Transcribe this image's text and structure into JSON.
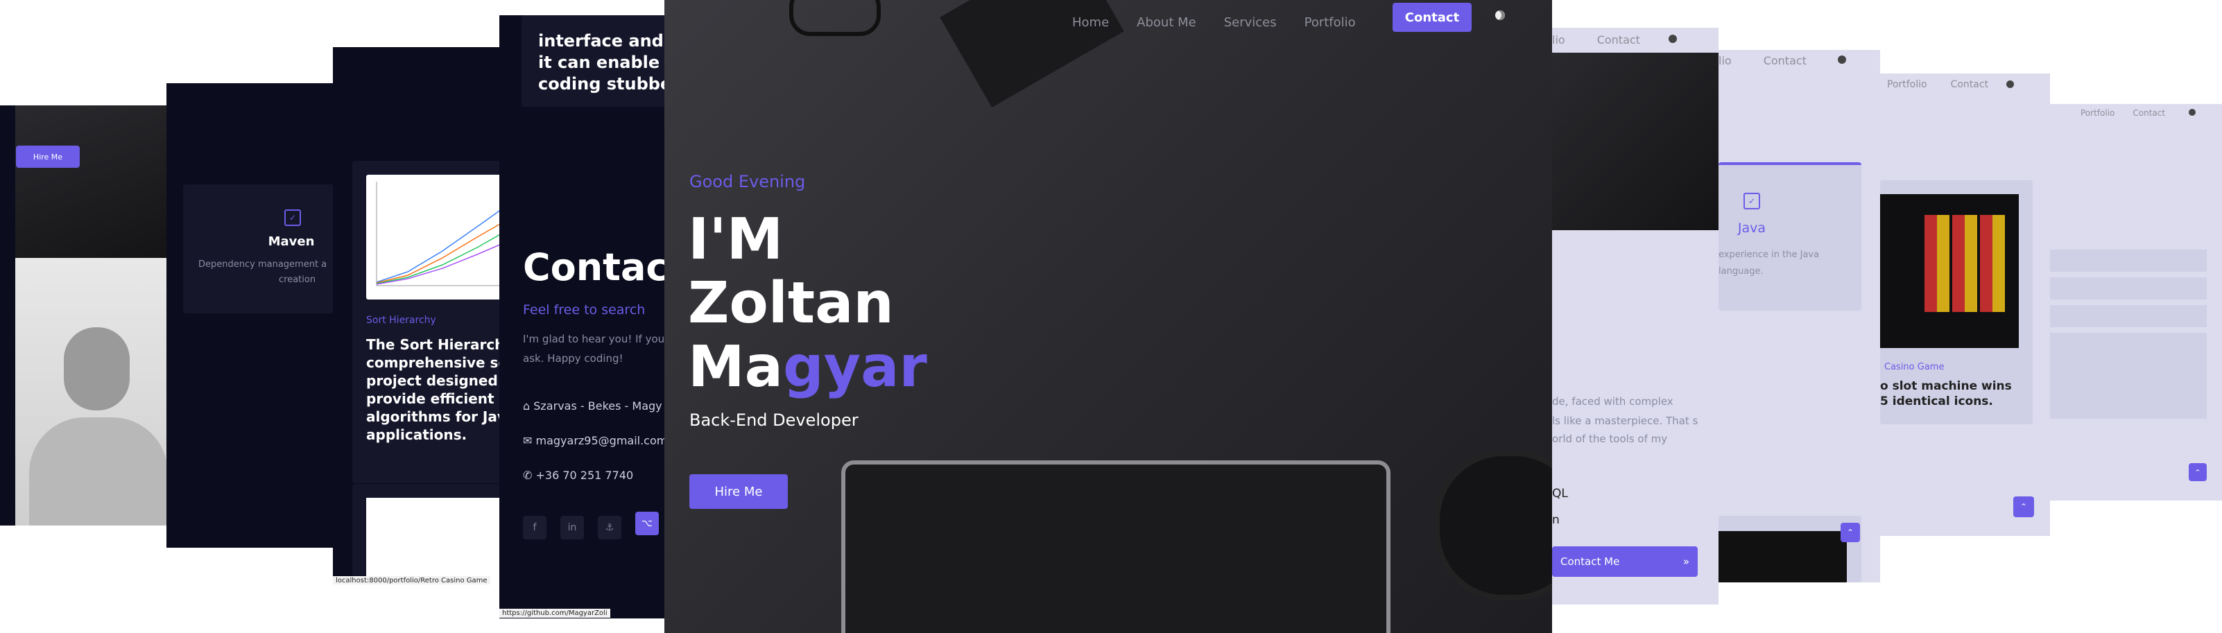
{
  "hero": {
    "nav": [
      "Home",
      "About Me",
      "Services",
      "Portfolio"
    ],
    "contact_btn": "Contact",
    "theme_icon": "moon-icon",
    "greeting": "Good Evening",
    "line1": "I'M",
    "name_first": "Zoltan",
    "name_last_a": "Ma",
    "name_last_b": "gyar",
    "role": "Back-End Developer",
    "hire_btn": "Hire Me"
  },
  "shot1": {
    "hire_btn": "Hire Me"
  },
  "shot2": {
    "card_title": "Maven",
    "card_desc": "Dependency management a",
    "card_desc2": "creation"
  },
  "shot3": {
    "category": "Sort Hierarchy",
    "heading": [
      "The Sort Hierarchy",
      "comprehensive sof",
      "project designed to",
      "provide efficient so",
      "algorithms for Java",
      "applications."
    ],
    "status_url": "localhost:8000/portfolio/Retro Casino Game"
  },
  "shot4": {
    "intro_lines": [
      "interface and th",
      "it can enable ov",
      "coding stubbed"
    ],
    "title": "Contact",
    "subtitle": "Feel free to search",
    "desc1": "I'm glad to hear you! If you",
    "desc2": "ask. Happy coding!",
    "address": "Szarvas - Bekes - Magy",
    "email": "magyarz95@gmail.com",
    "phone": "+36 70 251 7740",
    "social": [
      "f",
      "in",
      "⚓",
      "⌥"
    ],
    "status_url": "https://github.com/MagyarZoli"
  },
  "shot6": {
    "nav": [
      "lio",
      "Contact"
    ],
    "text1": "de, faced with complex",
    "text2": "ls like a masterpiece. That s",
    "text3": "orld of the tools of my",
    "list1": "QL",
    "list2": "n",
    "contact_btn": "Contact Me"
  },
  "shot7": {
    "nav": [
      "lio",
      "Contact"
    ],
    "card_title": "Java",
    "desc1": "experience in the Java",
    "desc2": "language."
  },
  "shot8": {
    "nav": [
      "Portfolio",
      "Contact"
    ],
    "category": "Casino Game",
    "title1": "o slot machine wins",
    "title2": "5 identical icons."
  },
  "shot9": {
    "nav": [
      "Portfolio",
      "Contact"
    ]
  },
  "colors": {
    "accent": "#6c5ce7",
    "dark_bg": "#0b0c1d",
    "light_bg": "#dcdcee"
  }
}
